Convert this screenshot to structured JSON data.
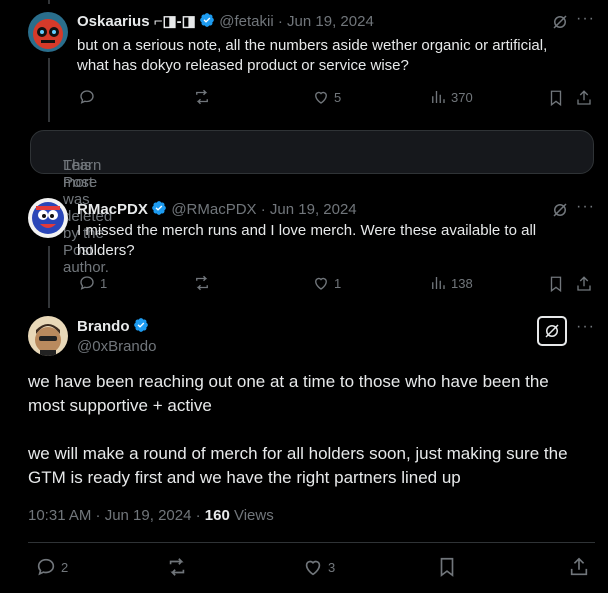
{
  "posts": [
    {
      "name": "Oskaarius ⌐◨-◨",
      "handle": "@fetakii",
      "date": "Jun 19, 2024",
      "text_line1": "but on a serious note, all the numbers aside wether organic or artificial,",
      "text_line2": "what has dokyo released product or service wise?",
      "replies": "",
      "reposts": "",
      "likes": "5",
      "views": "370"
    },
    {
      "name": "RMacPDX",
      "handle": "@RMacPDX",
      "date": "Jun 19, 2024",
      "text_line1": "I missed the merch runs and I love merch. Were these available to all",
      "text_line2": "holders?",
      "replies": "1",
      "reposts": "",
      "likes": "1",
      "views": "138"
    }
  ],
  "deleted": {
    "text": "This Post was deleted by the Post author.",
    "link": "Learn more"
  },
  "main": {
    "name": "Brando",
    "handle": "@0xBrando",
    "para1_line1": "we have been reaching out one at a time to those who have been the",
    "para1_line2": "most supportive + active",
    "para2_line1": "we will make a round of merch for all holders soon, just making sure the",
    "para2_line2": "GTM is ready first and we have the right partners lined up",
    "timestamp": "10:31 AM · Jun 19, 2024 · ",
    "views_count": "160",
    "views_label": " Views",
    "replies": "2",
    "likes": "3"
  },
  "separator": " · ",
  "colors": {
    "accent": "#1d9bf0",
    "muted": "#71767b",
    "text": "#e7e9ea",
    "border": "#2f3336"
  }
}
